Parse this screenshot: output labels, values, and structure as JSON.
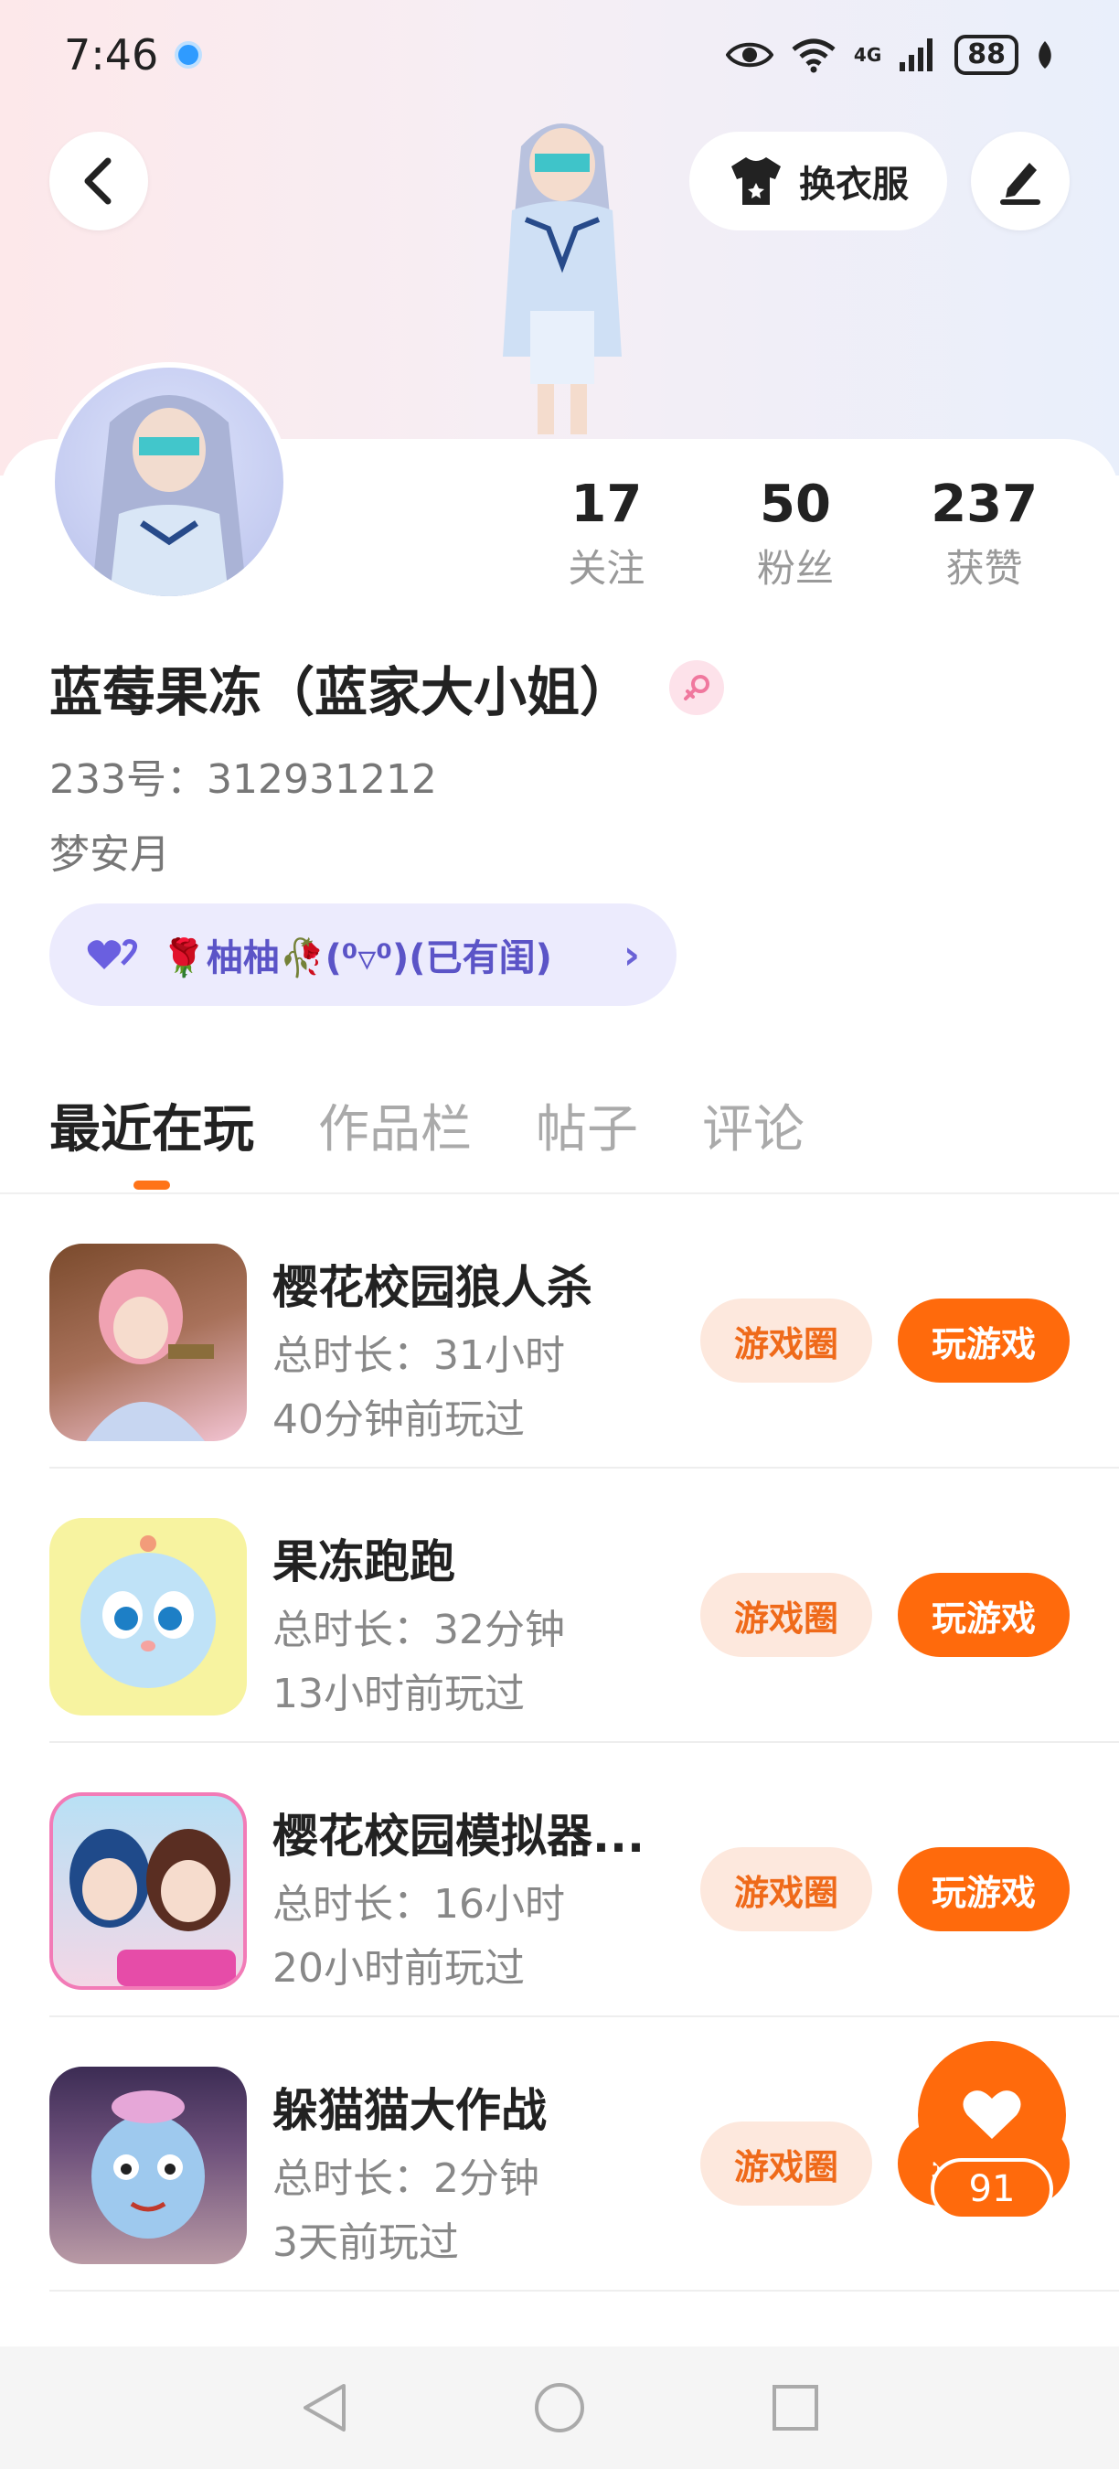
{
  "status_bar": {
    "time": "7:46",
    "battery": "88",
    "network": "4G"
  },
  "header": {
    "outfit_label": "换衣服"
  },
  "profile": {
    "stats": [
      {
        "value": "17",
        "label": "关注"
      },
      {
        "value": "50",
        "label": "粉丝"
      },
      {
        "value": "237",
        "label": "获赞"
      }
    ],
    "nickname": "蓝莓果冻（蓝家大小姐）",
    "id_text": "233号：312931212",
    "signature": "梦安月",
    "relation_text": "🌹柚柚🥀(⁰▿⁰)(已有闺)"
  },
  "tabs": [
    {
      "label": "最近在玩",
      "active": true
    },
    {
      "label": "作品栏",
      "active": false
    },
    {
      "label": "帖子",
      "active": false
    },
    {
      "label": "评论",
      "active": false
    }
  ],
  "games": [
    {
      "title": "樱花校园狼人杀",
      "duration": "总时长：31小时",
      "last_played": "40分钟前玩过",
      "circle_label": "游戏圈",
      "play_label": "玩游戏"
    },
    {
      "title": "果冻跑跑",
      "duration": "总时长：32分钟",
      "last_played": "13小时前玩过",
      "circle_label": "游戏圈",
      "play_label": "玩游戏"
    },
    {
      "title": "樱花校园模拟器...",
      "duration": "总时长：16小时",
      "last_played": "20小时前玩过",
      "circle_label": "游戏圈",
      "play_label": "玩游戏"
    },
    {
      "title": "躲猫猫大作战",
      "duration": "总时长：2分钟",
      "last_played": "3天前玩过",
      "circle_label": "游戏圈",
      "play_label": "玩游戏"
    }
  ],
  "like": {
    "count": "91"
  },
  "colors": {
    "accent": "#ff6a0c",
    "pill_bg": "#ecebfd",
    "pill_text": "#5b54c7"
  }
}
